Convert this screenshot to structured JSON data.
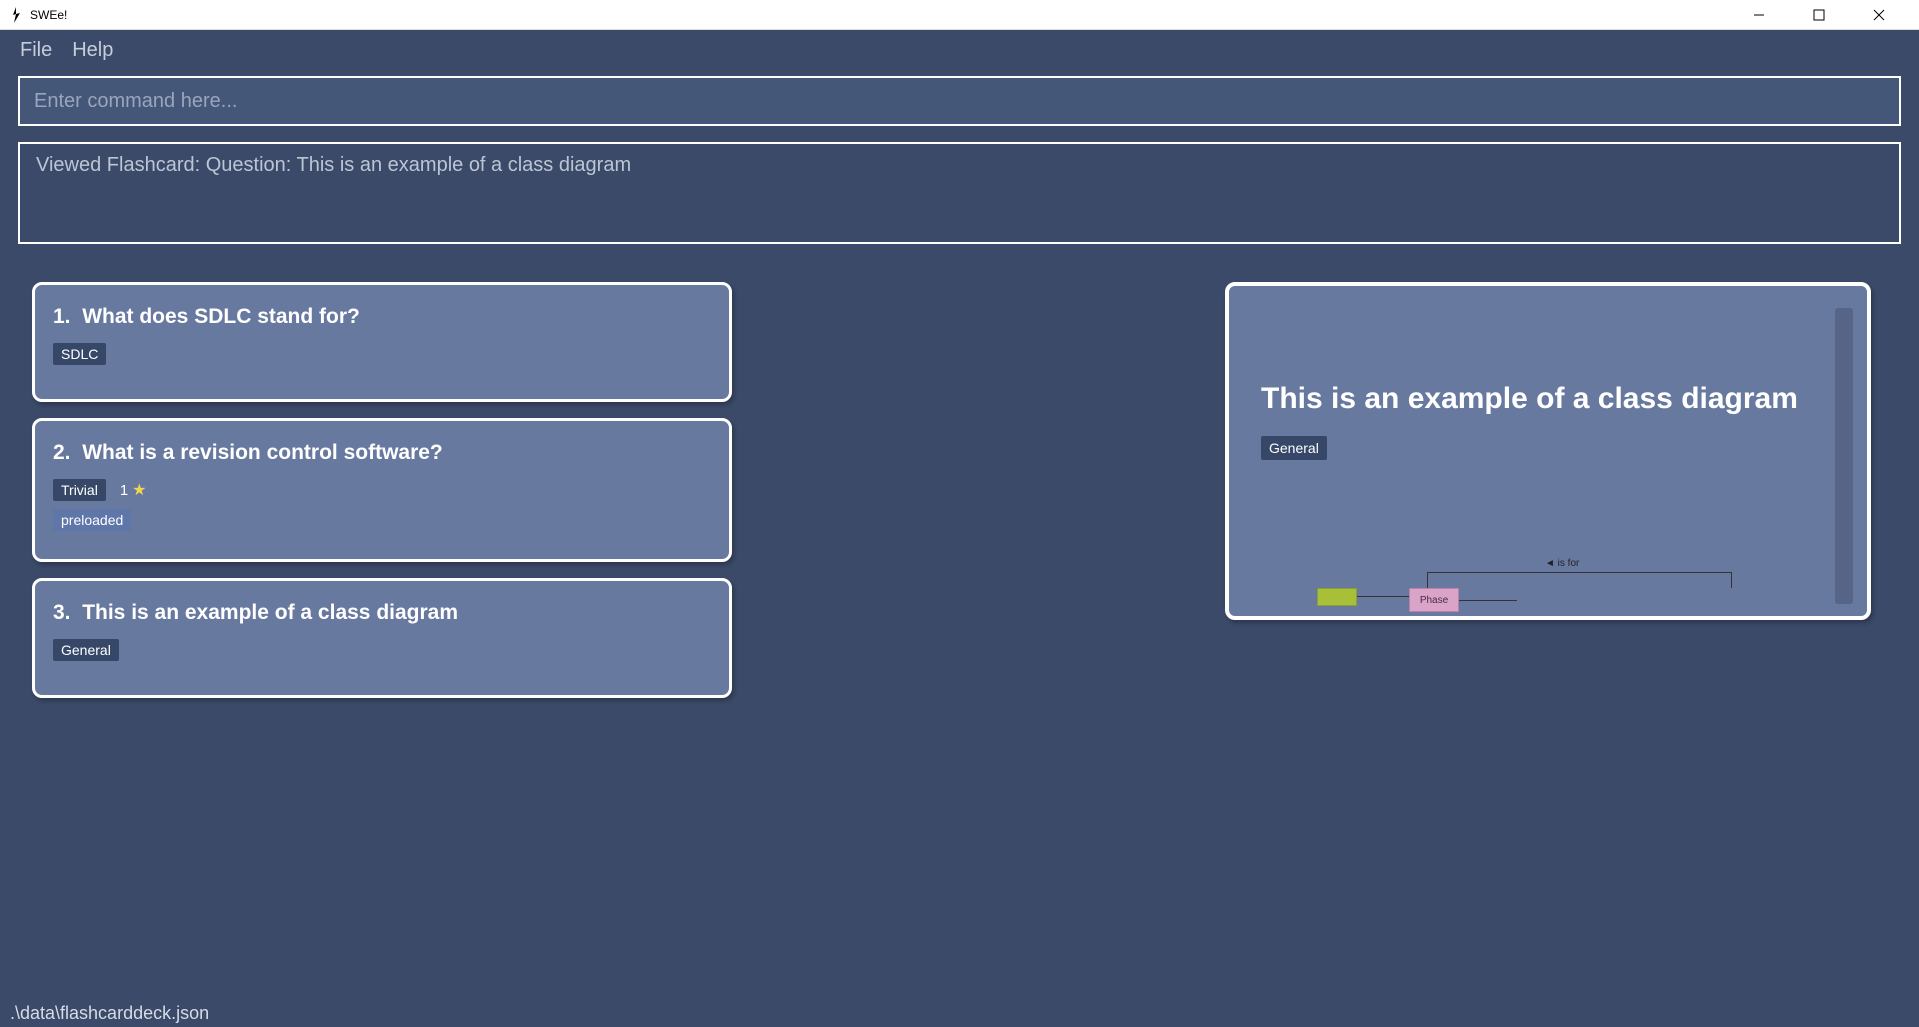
{
  "titlebar": {
    "title": "SWEe!"
  },
  "menubar": {
    "file": "File",
    "help": "Help"
  },
  "command": {
    "placeholder": "Enter command here..."
  },
  "output": {
    "text": "Viewed Flashcard:  Question: This is an example of a class diagram"
  },
  "cards": [
    {
      "number": "1.",
      "question": "What does SDLC stand for?",
      "tags": [
        "SDLC"
      ]
    },
    {
      "number": "2.",
      "question": "What is a revision control software?",
      "tags": [
        "Trivial"
      ],
      "rating": "1",
      "extra_tags": [
        "preloaded"
      ]
    },
    {
      "number": "3.",
      "question": "This is an example of a class diagram",
      "tags": [
        "General"
      ]
    }
  ],
  "detail": {
    "title": "This is an example of a class diagram",
    "tag": "General",
    "diagram": {
      "phase_label": "Phase",
      "is_for_label": "◄ is for"
    }
  },
  "statusbar": {
    "path": ".\\data\\flashcarddeck.json"
  }
}
